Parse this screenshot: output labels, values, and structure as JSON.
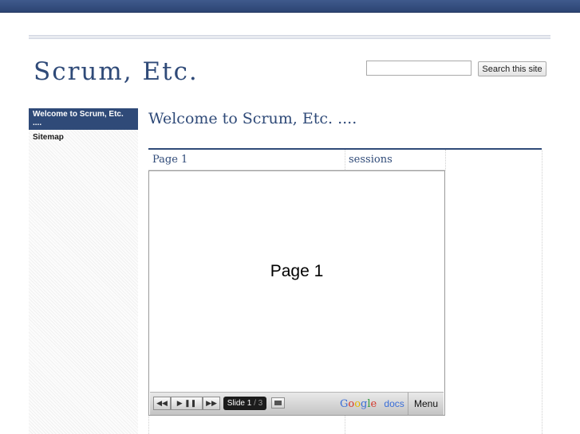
{
  "site": {
    "title": "Scrum, Etc."
  },
  "search": {
    "value": "",
    "placeholder": "",
    "button_label": "Search this site"
  },
  "sidebar": {
    "items": [
      {
        "label": "Welcome to Scrum, Etc. ....",
        "active": true
      },
      {
        "label": "Sitemap",
        "active": false
      }
    ]
  },
  "page": {
    "heading": "Welcome to Scrum, Etc. ....",
    "gadgets": [
      {
        "title": "Page 1"
      },
      {
        "title": "sessions"
      }
    ]
  },
  "presentation": {
    "slide_text": "Page 1",
    "controls": {
      "first_icon": "skip-back-icon",
      "play_icon": "play-icon",
      "pause_icon": "pause-icon",
      "next_icon": "skip-forward-icon",
      "slide_label": "Slide 1",
      "slide_separator": "/",
      "slide_total": "3",
      "fullscreen_icon": "fullscreen-icon",
      "brand_google": "Google",
      "brand_docs": "docs",
      "menu_label": "Menu"
    }
  },
  "colors": {
    "accent": "#2f4a78",
    "topbar": "#3f5a8c"
  }
}
